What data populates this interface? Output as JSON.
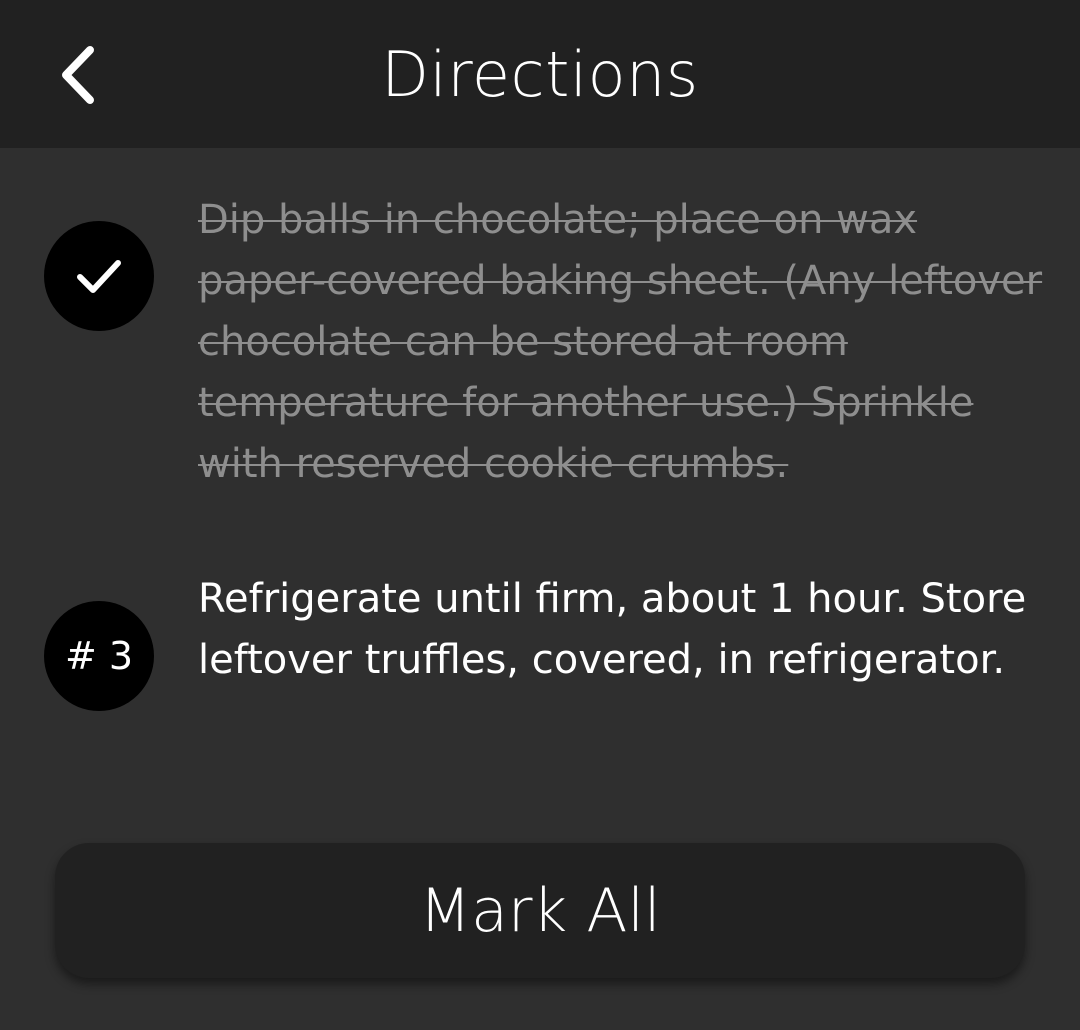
{
  "header": {
    "back_icon": "chevron-left-icon",
    "title": "Directions"
  },
  "steps": [
    {
      "status": "completed",
      "badge_icon": "checkmark-icon",
      "text": "Dip balls in chocolate; place on wax paper-covered baking sheet. (Any leftover chocolate can be stored at room temperature for another use.) Sprinkle with reserved cookie crumbs."
    },
    {
      "status": "pending",
      "badge_label": "# 3",
      "text": "Refrigerate until firm, about 1 hour. Store leftover truffles, covered, in refrigerator."
    }
  ],
  "footer": {
    "mark_all_label": "Mark All"
  },
  "colors": {
    "background": "#2f2f2f",
    "header_background": "#212121",
    "badge_background": "#000000",
    "completed_text": "#8e8e8e",
    "active_text": "#ffffff"
  }
}
